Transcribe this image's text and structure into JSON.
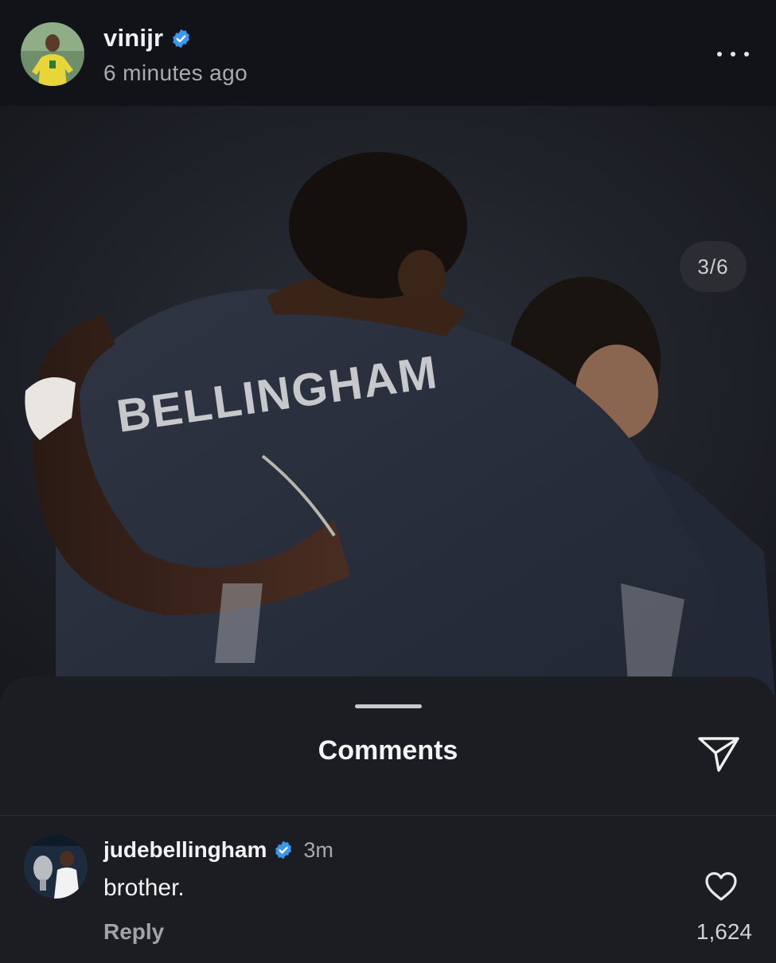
{
  "post": {
    "username": "vinijr",
    "timestamp": "6 minutes ago",
    "page_indicator": "3/6",
    "jersey_name": "BELLINGHAM"
  },
  "comments_sheet": {
    "title": "Comments",
    "comments": [
      {
        "username": "judebellingham",
        "time": "3m",
        "text": "brother.",
        "reply_label": "Reply",
        "likes": "1,624"
      }
    ]
  },
  "colors": {
    "header_bg": "#111318",
    "sheet_bg": "#1c1d22",
    "verified_blue": "#3897f0",
    "jersey": "#2a2f3b"
  },
  "icons": [
    "verified-icon",
    "more-icon",
    "share-icon",
    "heart-icon"
  ]
}
